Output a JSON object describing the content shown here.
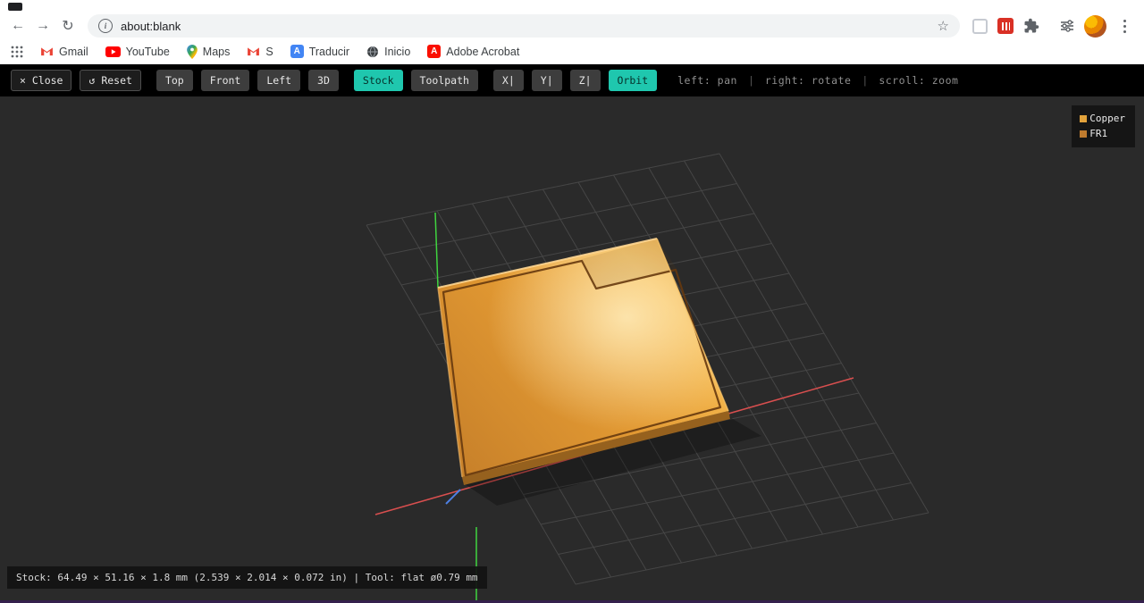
{
  "browser": {
    "nav": {
      "back_glyph": "←",
      "forward_glyph": "→",
      "reload_glyph": "↻",
      "info_glyph": "i",
      "star_glyph": "☆"
    },
    "omnibox": {
      "url": "about:blank"
    },
    "icons": {
      "translate_glyph": "A",
      "acrobat_glyph": "A"
    },
    "bookmarks": [
      {
        "label": "Gmail",
        "icon": "gmail-icon"
      },
      {
        "label": "YouTube",
        "icon": "youtube-icon"
      },
      {
        "label": "Maps",
        "icon": "maps-icon"
      },
      {
        "label": "S",
        "icon": "gmail-icon"
      },
      {
        "label": "Traducir",
        "icon": "translate-icon"
      },
      {
        "label": "Inicio",
        "icon": "globe-icon"
      },
      {
        "label": "Adobe Acrobat",
        "icon": "acrobat-icon"
      }
    ]
  },
  "cam": {
    "buttons": [
      {
        "label": "× Close"
      },
      {
        "label": "↺ Reset"
      },
      {
        "label": "Top"
      },
      {
        "label": "Front"
      },
      {
        "label": "Left"
      },
      {
        "label": "3D"
      },
      {
        "label": "Stock",
        "active": true
      },
      {
        "label": "Toolpath"
      },
      {
        "label": "X|"
      },
      {
        "label": "Y|"
      },
      {
        "label": "Z|"
      },
      {
        "label": "Orbit",
        "active": true
      }
    ],
    "hints": [
      "left: pan",
      "right: rotate",
      "scroll: zoom"
    ],
    "hint_sep": "|",
    "accent_color": "#1fc7ae"
  },
  "legend": {
    "items": [
      {
        "label": "Copper",
        "color": "#e2a23b"
      },
      {
        "label": "FR1",
        "color": "#bf7b2e"
      }
    ]
  },
  "status": {
    "text": "Stock: 64.49 × 51.16 × 1.8 mm (2.539 × 2.014 × 0.072 in) | Tool: flat ø0.79 mm"
  },
  "scene_colors": {
    "background": "#2a2a2a",
    "grid": "#464646",
    "axis_x": "#d94f4f",
    "axis_y": "#3fd43f",
    "axis_z": "#4d7fe3",
    "copper_light": "#f7bc55",
    "copper_dark": "#c8812a"
  }
}
